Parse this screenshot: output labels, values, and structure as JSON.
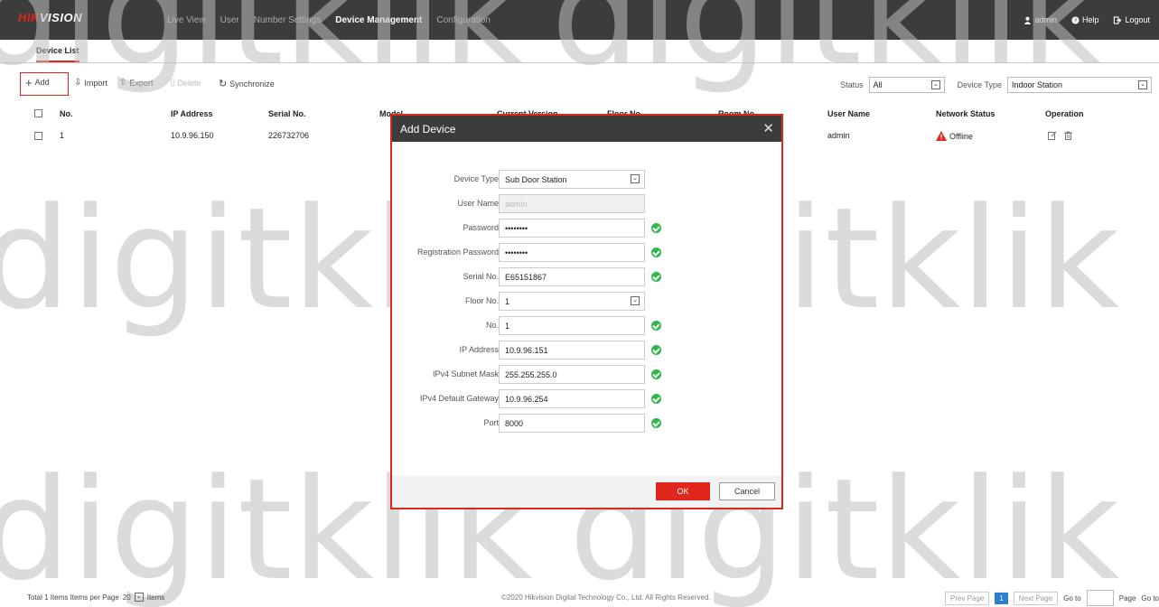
{
  "header": {
    "logo_red": "HIK",
    "logo_white": "VISION",
    "nav": [
      "Live View",
      "User",
      "Number Settings",
      "Device Management",
      "Configuration"
    ],
    "active_nav": "Device Management",
    "user": "admin",
    "help": "Help",
    "logout": "Logout"
  },
  "tabs": [
    "Device List"
  ],
  "toolbar": {
    "add": "Add",
    "import": "Import",
    "export": "Export",
    "delete": "Delete",
    "synchronize": "Synchronize"
  },
  "filters": {
    "status_label": "Status",
    "status_value": "All",
    "device_type_label": "Device Type",
    "device_type_value": "Indoor Station"
  },
  "table": {
    "columns": [
      "No.",
      "IP Address",
      "Serial No.",
      "Model",
      "Current Version",
      "Floor No.",
      "Room No.",
      "User Name",
      "Network Status",
      "Operation"
    ],
    "rows": [
      {
        "no": "1",
        "ip": "10.9.96.150",
        "serial": "226732706",
        "user": "admin",
        "status": "Offline"
      }
    ]
  },
  "dialog": {
    "title": "Add Device",
    "fields": [
      {
        "label": "Device Type",
        "value": "Sub Door Station",
        "kind": "select"
      },
      {
        "label": "User Name",
        "value": "admin",
        "kind": "disabled"
      },
      {
        "label": "Password",
        "value": "••••••••",
        "kind": "text"
      },
      {
        "label": "Registration Password",
        "value": "••••••••",
        "kind": "text"
      },
      {
        "label": "Serial No.",
        "value": "E65151867",
        "kind": "text"
      },
      {
        "label": "Floor No.",
        "value": "1",
        "kind": "select"
      },
      {
        "label": "No.",
        "value": "1",
        "kind": "text"
      },
      {
        "label": "IP Address",
        "value": "10.9.96.151",
        "kind": "text"
      },
      {
        "label": "IPv4 Subnet Mask",
        "value": "255.255.255.0",
        "kind": "text"
      },
      {
        "label": "IPv4 Default Gateway",
        "value": "10.9.96.254",
        "kind": "text"
      },
      {
        "label": "Port",
        "value": "8000",
        "kind": "text"
      }
    ],
    "ok": "OK",
    "cancel": "Cancel"
  },
  "footer": {
    "total": "Total 1 Items Items per Page",
    "per_page": "20",
    "items": "Items",
    "copyright": "©2020 Hikvision Digital Technology Co., Ltd. All Rights Reserved.",
    "prev": "Prev Page",
    "page": "1",
    "next": "Next Page",
    "goto": "Go to",
    "page_label": "Page",
    "go": "Go to"
  },
  "watermark": "digitklik",
  "colors": {
    "accent": "#e0271e",
    "topbar": "#3c3c3c",
    "ok": "#2eb84a",
    "page": "#2b7fd4"
  }
}
